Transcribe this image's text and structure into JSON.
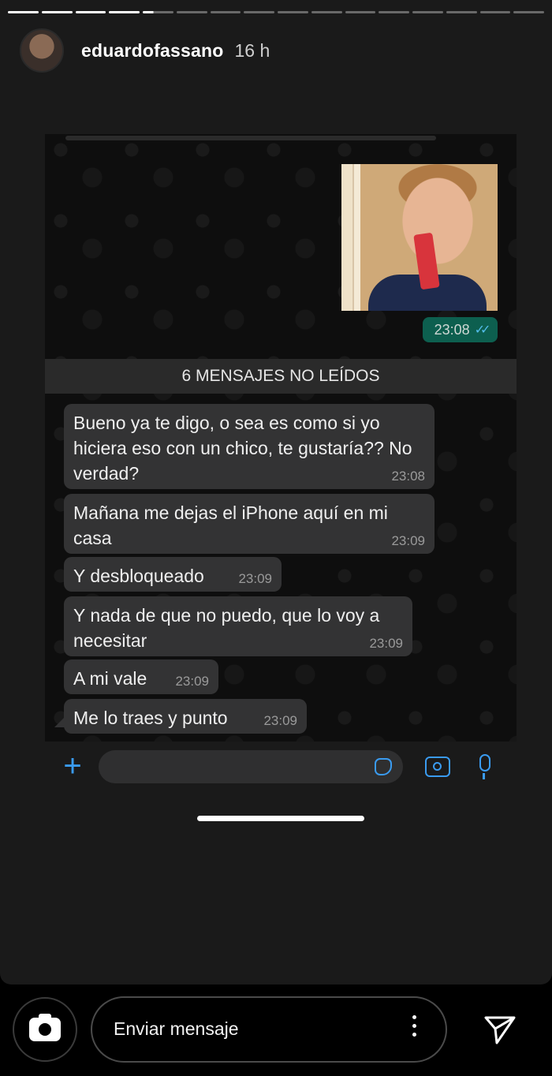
{
  "story": {
    "username": "eduardofassano",
    "time_ago": "16 h"
  },
  "chat": {
    "sent_photo_time": "23:08",
    "unread_banner": "6 MENSAJES NO LEÍDOS",
    "messages": [
      {
        "text": "Bueno ya te digo, o sea es como si yo hiciera eso con un chico, te gustaría?? No verdad?",
        "time": "23:08"
      },
      {
        "text": "Mañana me dejas el iPhone aquí en mi casa",
        "time": "23:09"
      },
      {
        "text": "Y desbloqueado",
        "time": "23:09"
      },
      {
        "text": "Y nada de que no puedo, que lo voy a necesitar",
        "time": "23:09"
      },
      {
        "text": "A mi vale",
        "time": "23:09"
      },
      {
        "text": "Me lo traes y punto",
        "time": "23:09"
      }
    ],
    "input_icons": [
      "plus-icon",
      "sticker-icon",
      "camera-icon",
      "microphone-icon"
    ]
  },
  "reply": {
    "placeholder": "Enviar mensaje",
    "icons": [
      "camera-icon",
      "more-icon",
      "send-icon"
    ]
  },
  "colors": {
    "accent_blue": "#3a9bf0",
    "bubble_in": "#333334",
    "bubble_out": "#0d5f4f",
    "read_tick": "#53bdeb"
  }
}
